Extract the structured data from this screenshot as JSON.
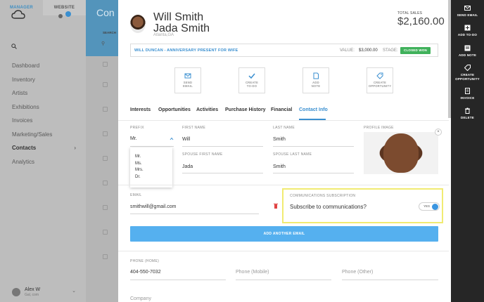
{
  "background": {
    "tabs": [
      "MANAGER",
      "WEBSITE"
    ],
    "nav": [
      "Dashboard",
      "Inventory",
      "Artists",
      "Exhibitions",
      "Invoices",
      "Marketing/Sales",
      "Contacts",
      "Analytics"
    ],
    "active_nav": "Contacts",
    "user_name": "Alex W",
    "user_sub": "Gal, com",
    "page_title": "Con",
    "table_header": "SEARCH"
  },
  "contact": {
    "name1": "Will Smith",
    "name2": "Jada Smith",
    "location": "Atlanta,GA",
    "total_sales_label": "TOTAL SALES",
    "total_sales": "$2,160.00"
  },
  "opportunity": {
    "name": "WILL DUNCAN - ANNIVERSARY PRESENT FOR WIFE",
    "value_label": "VALUE:",
    "value": "$3,000.00",
    "stage_label": "STAGE:",
    "stage": "CLOSED WON",
    "stage_color": "#40b15b"
  },
  "quick_actions": [
    {
      "icon": "mail-icon",
      "line1": "SEND",
      "line2": "EMAIL"
    },
    {
      "icon": "checkmark-icon",
      "line1": "CREATE",
      "line2": "TO-DO"
    },
    {
      "icon": "note-icon",
      "line1": "ADD",
      "line2": "NOTE"
    },
    {
      "icon": "tag-icon",
      "line1": "CREATE",
      "line2": "OPPORTUNITY"
    }
  ],
  "tabs": [
    "Interests",
    "Opportunities",
    "Activities",
    "Purchase History",
    "Financial",
    "Contact Info"
  ],
  "active_tab": "Contact Info",
  "form": {
    "prefix_label": "PREFIX",
    "prefix_value": "Mr.",
    "prefix_options": [
      "Mr.",
      "Ms.",
      "Mrs.",
      "Dr."
    ],
    "first_name_label": "FIRST NAME",
    "first_name": "Will",
    "last_name_label": "LAST NAME",
    "last_name": "Smith",
    "profile_image_label": "PROFILE IMAGE",
    "spouse_first_label": "SPOUSE FIRST NAME",
    "spouse_first": "Jada",
    "spouse_last_label": "SPOUSE LAST NAME",
    "spouse_last": "Smith",
    "email_label": "EMAIL",
    "email": "smithwill@gmail.com",
    "subscription_label": "COMMUNICATIONS SUBSCRIPTION",
    "subscription_question": "Subscribe to communications?",
    "subscription_toggle": "YES",
    "add_email": "ADD ANOTHER EMAIL",
    "phone_home_label": "PHONE (HOME)",
    "phone_home": "404-550-7032",
    "phone_mobile_placeholder": "Phone (Mobile)",
    "phone_other_placeholder": "Phone (Other)",
    "company_placeholder": "Company"
  },
  "actionbar": [
    {
      "icon": "mail-icon",
      "line1": "SEND EMAIL",
      "line2": ""
    },
    {
      "icon": "plus-icon",
      "line1": "ADD TO-DO",
      "line2": ""
    },
    {
      "icon": "note-icon",
      "line1": "ADD NOTE",
      "line2": ""
    },
    {
      "icon": "tag-icon",
      "line1": "CREATE",
      "line2": "OPPORTUNITY"
    },
    {
      "icon": "invoice-icon",
      "line1": "INVOICE",
      "line2": ""
    },
    {
      "icon": "trash-icon",
      "line1": "DELETE",
      "line2": ""
    }
  ],
  "colors": {
    "accent": "#3a8fd0",
    "button": "#55b0ef",
    "highlight": "#f1eb72",
    "actionbar": "#262626"
  }
}
